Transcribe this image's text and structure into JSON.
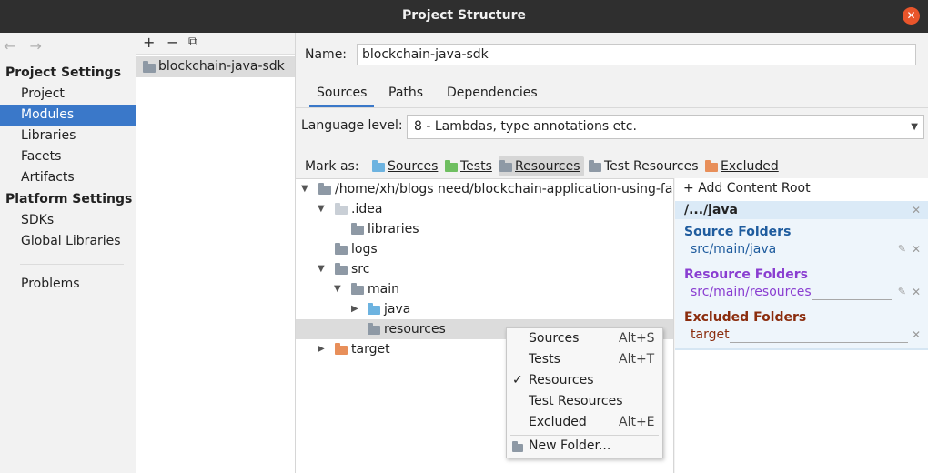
{
  "window": {
    "title": "Project Structure"
  },
  "sidebar": {
    "nav_back": "←",
    "nav_forward": "→",
    "project_settings_heading": "Project Settings",
    "project_items": [
      "Project",
      "Modules",
      "Libraries",
      "Facets",
      "Artifacts"
    ],
    "selected_item": "Modules",
    "platform_settings_heading": "Platform Settings",
    "platform_items": [
      "SDKs",
      "Global Libraries"
    ],
    "problems": "Problems"
  },
  "modules": {
    "toolbar": {
      "add": "+",
      "remove": "−",
      "copy": "⧉"
    },
    "items": [
      "blockchain-java-sdk"
    ]
  },
  "module_editor": {
    "name_label": "Name:",
    "name_value": "blockchain-java-sdk",
    "tabs": [
      "Sources",
      "Paths",
      "Dependencies"
    ],
    "active_tab": "Sources",
    "language_level_label": "Language level:",
    "language_level_value": "8 - Lambdas, type annotations etc.",
    "mark_as_label": "Mark as:",
    "mark_as": [
      {
        "label": "Sources",
        "color": "#6db3e0"
      },
      {
        "label": "Tests",
        "color": "#6fbf61"
      },
      {
        "label": "Resources",
        "color": "#9aa3ad"
      },
      {
        "label": "Test Resources",
        "color": "#9aa3ad"
      },
      {
        "label": "Excluded",
        "color": "#e88f5a"
      }
    ],
    "active_mark": "Resources"
  },
  "tree": {
    "root": "/home/xh/blogs need/blockchain-application-using-fal",
    "nodes": [
      ".idea",
      "libraries",
      "logs",
      "src",
      "main",
      "java",
      "resources",
      "target"
    ],
    "selected": "resources"
  },
  "content_root": {
    "add_label": "Add Content Root",
    "root_path": "/.../java",
    "source_heading": "Source Folders",
    "source_path": "src/main/java",
    "resource_heading": "Resource Folders",
    "resource_path": "src/main/resources",
    "excluded_heading": "Excluded Folders",
    "excluded_path": "target",
    "colors": {
      "source": "#1f5c9e",
      "resource": "#8a3ed1",
      "excluded": "#8b2d0e"
    }
  },
  "context_menu": {
    "items": [
      {
        "label": "Sources",
        "shortcut": "Alt+S"
      },
      {
        "label": "Tests",
        "shortcut": "Alt+T"
      },
      {
        "label": "Resources",
        "shortcut": ""
      },
      {
        "label": "Test Resources",
        "shortcut": ""
      },
      {
        "label": "Excluded",
        "shortcut": "Alt+E"
      }
    ],
    "checked": "Resources",
    "check_mark": "✓",
    "new_folder": "New Folder..."
  }
}
